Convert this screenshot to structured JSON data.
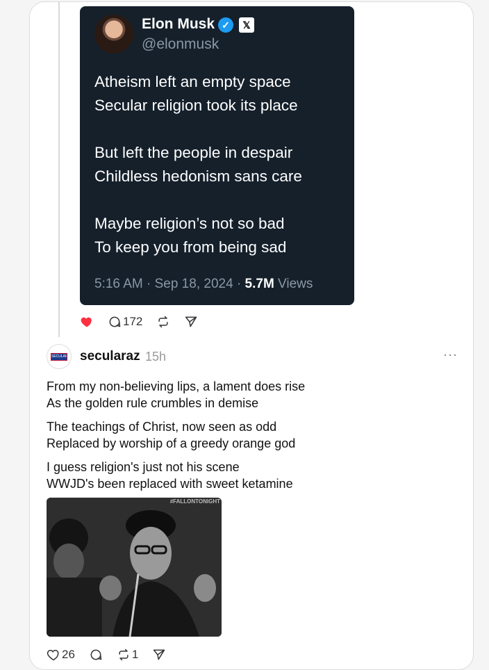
{
  "quoted_tweet": {
    "author_name": "Elon Musk",
    "verified_glyph": "✓",
    "x_logo": "𝕏",
    "handle": "@elonmusk",
    "stanzas": [
      [
        "Atheism left an empty space",
        "Secular religion took its place"
      ],
      [
        "But left the people in despair",
        "Childless hedonism sans care"
      ],
      [
        "Maybe religion’s not so bad",
        "To keep you from being sad"
      ]
    ],
    "timestamp": "5:16 AM · Sep 18, 2024 · ",
    "views_count": "5.7M",
    "views_label": " Views"
  },
  "parent_actions": {
    "liked": true,
    "reply_count": "172"
  },
  "reply_post": {
    "avatar_text": "SECULAR",
    "username": "secularaz",
    "time": "15h",
    "more_glyph": "···",
    "stanzas": [
      [
        "From my non-believing lips, a lament does rise",
        "As the golden rule crumbles in demise"
      ],
      [
        "The teachings of Christ, now seen as odd",
        "Replaced by worship of a greedy orange god"
      ],
      [
        "I guess religion's just not his scene",
        "WWJD's been replaced with sweet ketamine"
      ]
    ],
    "gif_watermark": "#FALLONTONIGHT",
    "like_count": "26",
    "repost_count": "1"
  },
  "colors": {
    "heart": "#ff3040",
    "tweet_bg": "#15202b",
    "verified": "#1d9bf0"
  }
}
